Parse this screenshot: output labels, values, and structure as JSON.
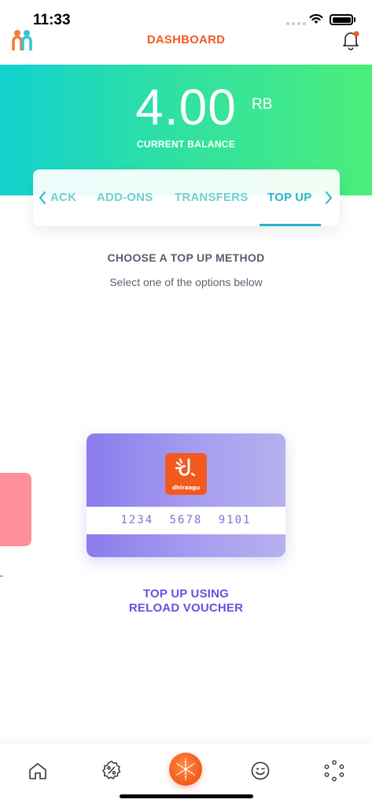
{
  "status_bar": {
    "time": "11:33"
  },
  "header": {
    "title": "DASHBOARD"
  },
  "balance": {
    "value": "4.00",
    "unit": "RB",
    "label": "CURRENT BALANCE"
  },
  "tabs": [
    {
      "label": "ACK",
      "active": false
    },
    {
      "label": "ADD-ONS",
      "active": false
    },
    {
      "label": "TRANSFERS",
      "active": false
    },
    {
      "label": "TOP UP",
      "active": true
    }
  ],
  "section": {
    "title": "CHOOSE A TOP UP METHOD",
    "subtitle": "Select one of the options below"
  },
  "voucher_card": {
    "brand": "dhiraagu",
    "number": "1234 5678 9101",
    "caption_line1": "TOP UP USING",
    "caption_line2": "RELOAD VOUCHER"
  },
  "bottom_nav": {
    "items": [
      {
        "icon": "home-icon"
      },
      {
        "icon": "offers-percent-icon"
      },
      {
        "icon": "starburst-center-icon"
      },
      {
        "icon": "smiley-icon"
      },
      {
        "icon": "dots-circle-icon"
      }
    ]
  },
  "colors": {
    "accent_orange": "#f05a23",
    "hero_gradient_start": "#12d2cf",
    "hero_gradient_end": "#4bee7a",
    "tab_active": "#27b5c9",
    "tab_inactive": "#6fcfcf",
    "voucher_purple": "#8a7cec",
    "caption_purple": "#6a4fe0"
  }
}
